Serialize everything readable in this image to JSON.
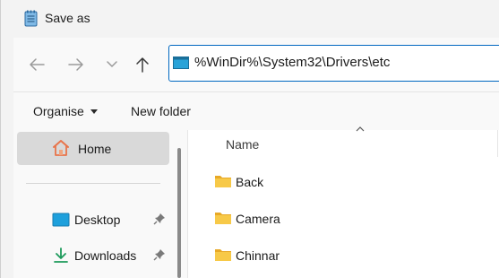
{
  "window": {
    "title": "Save as",
    "title_icon": "notepad-icon"
  },
  "navigation": {
    "back_icon": "arrow-left-icon",
    "forward_icon": "arrow-right-icon",
    "recent_icon": "chevron-down-icon",
    "up_icon": "arrow-up-icon",
    "address": {
      "icon": "address-bar-icon",
      "value": "%WinDir%\\System32\\Drivers\\etc"
    }
  },
  "command_bar": {
    "organise_label": "Organise",
    "new_folder_label": "New folder"
  },
  "nav_pane": {
    "home": {
      "label": "Home",
      "icon": "home-icon",
      "selected": true
    },
    "items": [
      {
        "label": "Desktop",
        "icon": "desktop-icon",
        "pinned": true
      },
      {
        "label": "Downloads",
        "icon": "download-icon",
        "pinned": true
      }
    ]
  },
  "file_list": {
    "columns": [
      {
        "label": "Name",
        "sort": "ascending"
      }
    ],
    "rows": [
      {
        "name": "Back",
        "icon": "folder-icon"
      },
      {
        "name": "Camera",
        "icon": "folder-icon"
      },
      {
        "name": "Chinnar",
        "icon": "folder-icon"
      }
    ]
  },
  "colors": {
    "accent": "#0067c0",
    "folder": "#f4c34a",
    "selected_bg": "#d9d9d9"
  }
}
